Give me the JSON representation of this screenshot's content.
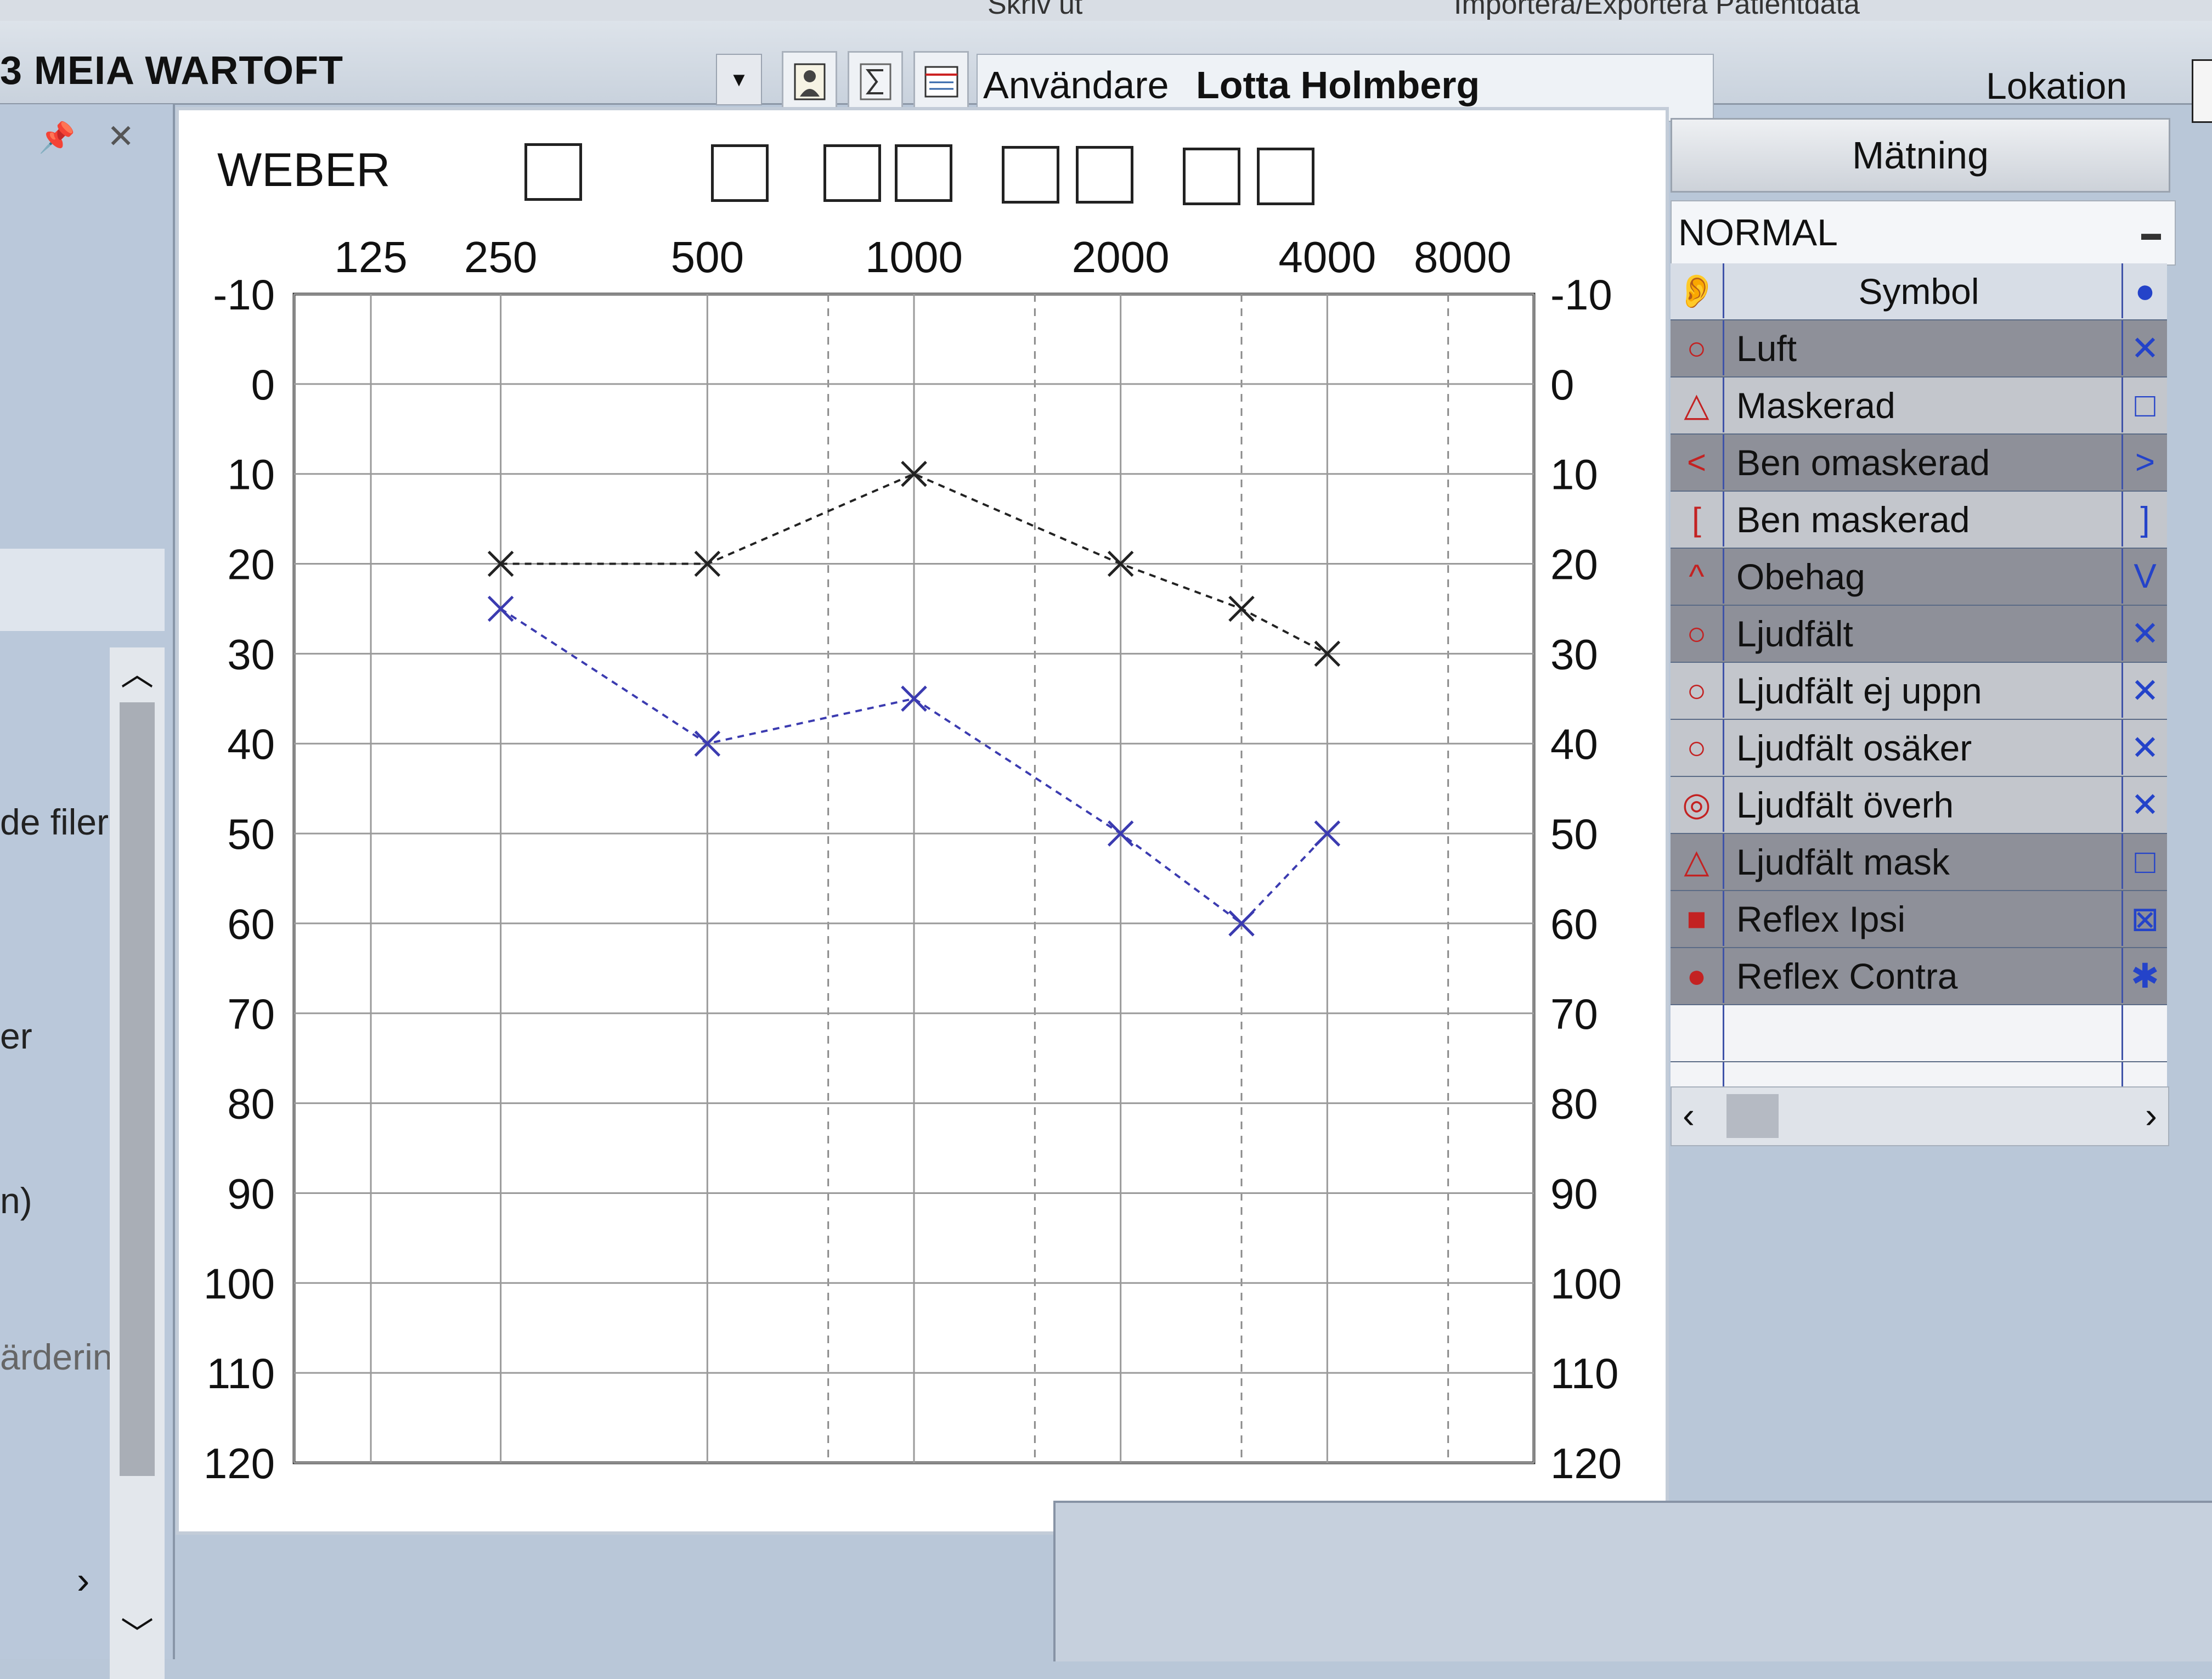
{
  "top_menu": {
    "left_text": "Skriv ut",
    "right_text": "Importera/Exportera Patientdata"
  },
  "header": {
    "patient_name": "3 MEIA WARTOFT",
    "user_label": "Användare",
    "user_name": "Lotta Holmberg",
    "lokation_label": "Lokation"
  },
  "left_panel": {
    "texts": [
      "de filer",
      "er",
      "n)",
      "ärderin"
    ]
  },
  "chart": {
    "weber_label": "WEBER",
    "freq_labels": [
      "125",
      "250",
      "500",
      "1000",
      "2000",
      "4000",
      "8000"
    ],
    "db_labels": [
      "-10",
      "0",
      "10",
      "20",
      "30",
      "40",
      "50",
      "60",
      "70",
      "80",
      "90",
      "100",
      "110",
      "120"
    ]
  },
  "chart_data": {
    "type": "line",
    "x_scale": "log2",
    "x": [
      250,
      500,
      1000,
      2000,
      3000,
      4000
    ],
    "xlim": [
      125,
      8000
    ],
    "ylim": [
      -10,
      120
    ],
    "y_inverted": true,
    "grid": true,
    "series": [
      {
        "color": "#222222",
        "marker": "x",
        "values": [
          20,
          20,
          10,
          20,
          25,
          30
        ]
      },
      {
        "color": "#3b3bb0",
        "marker": "x",
        "values": [
          25,
          40,
          35,
          50,
          60,
          50
        ]
      }
    ]
  },
  "legend": {
    "title": "Mätning",
    "mode": "NORMAL",
    "header": "Symbol",
    "rows": [
      {
        "name": "Luft",
        "left": "○",
        "right": "✕",
        "shade": "dark"
      },
      {
        "name": "Maskerad",
        "left": "△",
        "right": "□",
        "shade": "light"
      },
      {
        "name": "Ben omaskerad",
        "left": "<",
        "right": ">",
        "shade": "dark"
      },
      {
        "name": "Ben maskerad",
        "left": "[",
        "right": "]",
        "shade": "light"
      },
      {
        "name": "Obehag",
        "left": "^",
        "right": "V",
        "shade": "dark"
      },
      {
        "name": "Ljudfält",
        "left": "○",
        "right": "✕",
        "shade": "dark"
      },
      {
        "name": "Ljudfält ej uppn",
        "left": "○",
        "right": "✕",
        "shade": "light"
      },
      {
        "name": "Ljudfält osäker",
        "left": "○",
        "right": "✕",
        "shade": "light"
      },
      {
        "name": "Ljudfält överh",
        "left": "◎",
        "right": "✕",
        "shade": "light"
      },
      {
        "name": "Ljudfält mask",
        "left": "△",
        "right": "□",
        "shade": "dark"
      },
      {
        "name": "Reflex Ipsi",
        "left": "■",
        "right": "⊠",
        "shade": "dark"
      },
      {
        "name": "Reflex Contra",
        "left": "●",
        "right": "✱",
        "shade": "dark"
      }
    ]
  }
}
